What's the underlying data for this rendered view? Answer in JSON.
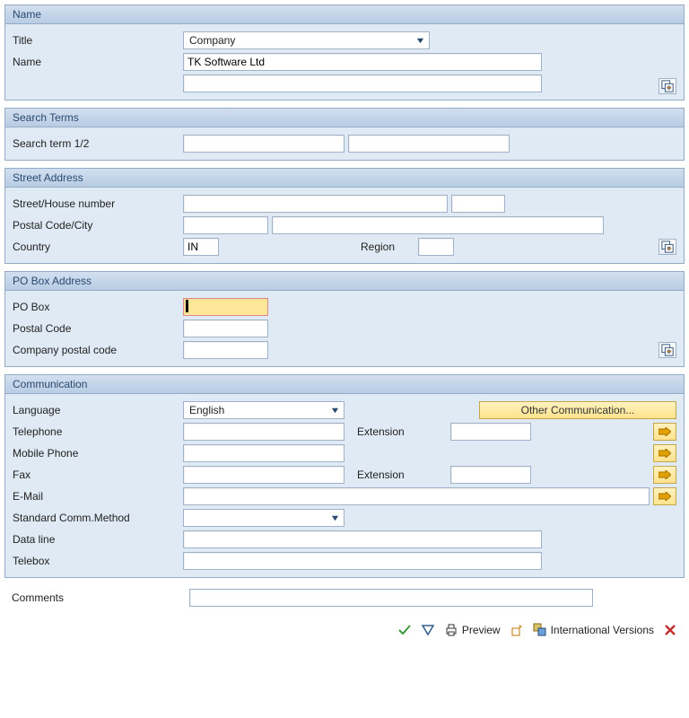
{
  "name_section": {
    "header": "Name",
    "title_label": "Title",
    "title_value": "Company",
    "name_label": "Name",
    "name_value": "TK Software Ltd",
    "name_value2": ""
  },
  "search_section": {
    "header": "Search Terms",
    "label": "Search term 1/2",
    "term1": "",
    "term2": ""
  },
  "street_section": {
    "header": "Street Address",
    "street_label": "Street/House number",
    "street": "",
    "house_no": "",
    "postal_city_label": "Postal Code/City",
    "postal": "",
    "city": "",
    "country_label": "Country",
    "country": "IN",
    "region_label": "Region",
    "region": ""
  },
  "pobox_section": {
    "header": "PO Box Address",
    "pobox_label": "PO Box",
    "pobox": "",
    "postal_label": "Postal Code",
    "postal": "",
    "company_postal_label": "Company postal code",
    "company_postal": ""
  },
  "comm_section": {
    "header": "Communication",
    "language_label": "Language",
    "language_value": "English",
    "other_comm_label": "Other Communication...",
    "telephone_label": "Telephone",
    "telephone": "",
    "extension_label": "Extension",
    "tel_ext": "",
    "mobile_label": "Mobile Phone",
    "mobile": "",
    "fax_label": "Fax",
    "fax": "",
    "fax_ext": "",
    "email_label": "E-Mail",
    "email": "",
    "stdcomm_label": "Standard Comm.Method",
    "stdcomm_value": "",
    "dataline_label": "Data line",
    "dataline": "",
    "telebox_label": "Telebox",
    "telebox": ""
  },
  "comments_label": "Comments",
  "comments": "",
  "footer": {
    "preview": "Preview",
    "intl": "International Versions"
  }
}
